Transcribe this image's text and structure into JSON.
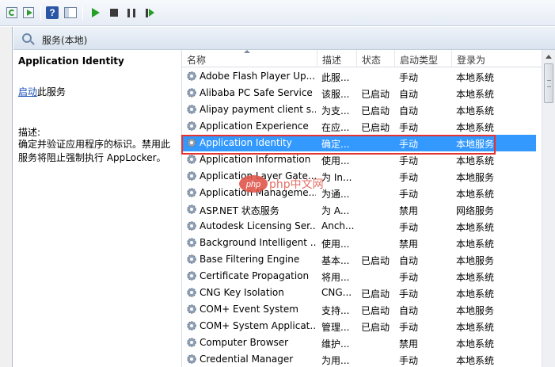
{
  "header": {
    "title": "服务(本地)"
  },
  "selected_service": {
    "name": "Application Identity",
    "action_link": "启动",
    "action_suffix": "此服务",
    "desc_label": "描述:",
    "description": "确定并验证应用程序的标识。禁用此服务将阻止强制执行 AppLocker。"
  },
  "columns": {
    "name": "名称",
    "desc": "描述",
    "status": "状态",
    "startup": "启动类型",
    "logon": "登录为"
  },
  "services": [
    {
      "name": "Adobe Flash Player Up...",
      "desc": "此服...",
      "status": "",
      "startup": "手动",
      "logon": "本地系统"
    },
    {
      "name": "Alibaba PC Safe Service",
      "desc": "该服...",
      "status": "已启动",
      "startup": "自动",
      "logon": "本地系统"
    },
    {
      "name": "Alipay payment client s...",
      "desc": "为支...",
      "status": "已启动",
      "startup": "自动",
      "logon": "本地系统"
    },
    {
      "name": "Application Experience",
      "desc": "在应...",
      "status": "已启动",
      "startup": "手动",
      "logon": "本地系统"
    },
    {
      "name": "Application Identity",
      "desc": "确定...",
      "status": "",
      "startup": "手动",
      "logon": "本地服务"
    },
    {
      "name": "Application Information",
      "desc": "使用...",
      "status": "",
      "startup": "手动",
      "logon": "本地系统"
    },
    {
      "name": "Application Layer Gate...",
      "desc": "为 In...",
      "status": "",
      "startup": "手动",
      "logon": "本地服务"
    },
    {
      "name": "Application Manageme...",
      "desc": "为通...",
      "status": "",
      "startup": "手动",
      "logon": "本地系统"
    },
    {
      "name": "ASP.NET 状态服务",
      "desc": "为 A...",
      "status": "",
      "startup": "禁用",
      "logon": "网络服务"
    },
    {
      "name": "Autodesk Licensing Ser...",
      "desc": "Anch...",
      "status": "",
      "startup": "手动",
      "logon": "本地系统"
    },
    {
      "name": "Background Intelligent ...",
      "desc": "使用...",
      "status": "",
      "startup": "禁用",
      "logon": "本地系统"
    },
    {
      "name": "Base Filtering Engine",
      "desc": "基本...",
      "status": "已启动",
      "startup": "自动",
      "logon": "本地服务"
    },
    {
      "name": "Certificate Propagation",
      "desc": "将用...",
      "status": "",
      "startup": "手动",
      "logon": "本地系统"
    },
    {
      "name": "CNG Key Isolation",
      "desc": "CNG...",
      "status": "已启动",
      "startup": "手动",
      "logon": "本地系统"
    },
    {
      "name": "COM+ Event System",
      "desc": "支持...",
      "status": "已启动",
      "startup": "自动",
      "logon": "本地服务"
    },
    {
      "name": "COM+ System Applicat...",
      "desc": "管理...",
      "status": "已启动",
      "startup": "手动",
      "logon": "本地系统"
    },
    {
      "name": "Computer Browser",
      "desc": "维护...",
      "status": "",
      "startup": "禁用",
      "logon": "本地系统"
    },
    {
      "name": "Credential Manager",
      "desc": "为用...",
      "status": "",
      "startup": "手动",
      "logon": "本地系统"
    }
  ],
  "selected_index": 4,
  "watermark": "php中文网",
  "colors": {
    "selection": "#3399ff",
    "highlight_border": "#e53333",
    "link": "#1a4fb8"
  }
}
